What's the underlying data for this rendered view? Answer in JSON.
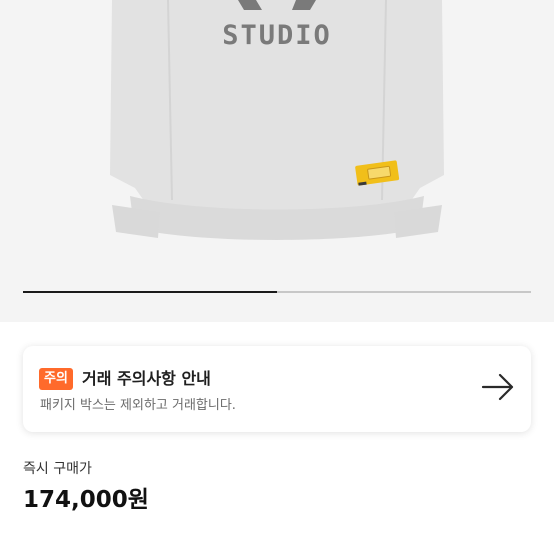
{
  "product": {
    "print_text": "STUDIO",
    "carousel_progress": 0.5
  },
  "notice": {
    "badge": "주의",
    "title": "거래 주의사항 안내",
    "description": "패키지 박스는 제외하고 거래합니다."
  },
  "purchase": {
    "label": "즉시 구매가",
    "price": "174,000원"
  },
  "colors": {
    "badge": "#ff6a2b",
    "garment": "#e3e3e3",
    "tag": "#f1bf1a"
  }
}
